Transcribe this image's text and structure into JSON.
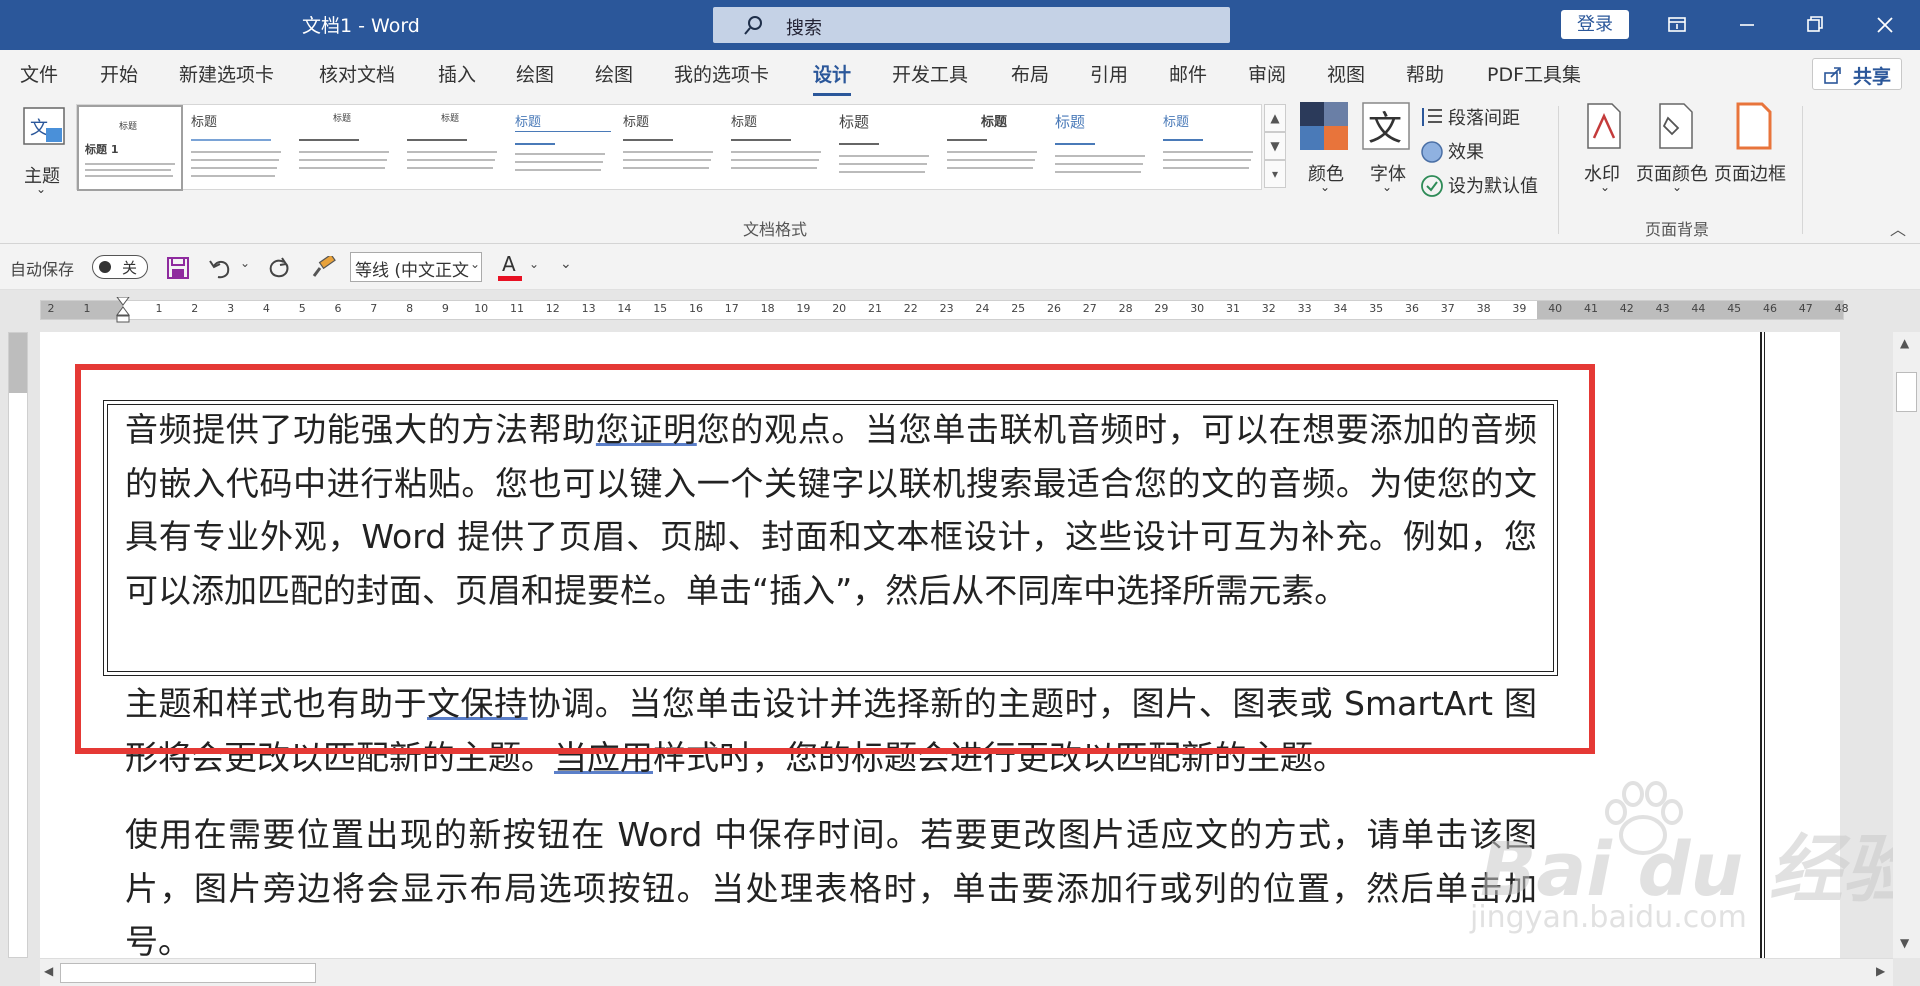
{
  "window": {
    "title": "文档1  -  Word",
    "search_label": "搜索",
    "login_label": "登录"
  },
  "menu": {
    "items": [
      "文件",
      "开始",
      "新建选项卡",
      "核对文档",
      "插入",
      "绘图",
      "绘图",
      "我的选项卡",
      "设计",
      "开发工具",
      "布局",
      "引用",
      "邮件",
      "审阅",
      "视图",
      "帮助",
      "PDF工具集"
    ],
    "active": "设计",
    "share_label": "共享"
  },
  "ribbon": {
    "theme_label": "主题",
    "gallery_heading": "标题",
    "gallery_group_label": "文档格式",
    "colors_label": "颜色",
    "fonts_label": "字体",
    "para_spacing_label": "段落间距",
    "effects_label": "效果",
    "set_default_label": "设为默认值",
    "watermark_label": "水印",
    "page_color_label": "页面颜色",
    "page_border_label": "页面边框",
    "page_bg_group_label": "页面背景"
  },
  "qat": {
    "autosave_label": "自动保存",
    "toggle_state": "关",
    "font_name": "等线 (中文正文"
  },
  "ruler": {
    "left_numbers": [
      "2",
      "1"
    ],
    "numbers": [
      "1",
      "2",
      "3",
      "4",
      "5",
      "6",
      "7",
      "8",
      "9",
      "10",
      "11",
      "12",
      "13",
      "14",
      "15",
      "16",
      "17",
      "18",
      "19",
      "20",
      "21",
      "22",
      "23",
      "24",
      "25",
      "26",
      "27",
      "28",
      "29",
      "30",
      "31",
      "32",
      "33",
      "34",
      "35",
      "36",
      "37",
      "38",
      "39",
      "40",
      "41",
      "42",
      "43",
      "44",
      "45",
      "46",
      "47",
      "48"
    ]
  },
  "document": {
    "para1": [
      "音频提供了功能强大的方法帮助",
      "您证明",
      "您的观点。当您单击联机音频时，可以在想要添加的音频的嵌入代码中进行粘贴。您也可以键入一个关键字以联机搜索最适合您的文的音频。为使您的文具有专业外观，Word 提供了页眉、页脚、封面和文本框设计，这些设计可互为补充。例如，您可以添加匹配的封面、页眉和提要栏。单击“插入”，然后从不同库中选择所需元素。"
    ],
    "para2": [
      "主题和样式也有助于",
      "文保持",
      "协调。当您单击设计并选择新的主题时，图片、图表或 SmartArt 图形将会更改以匹配新的主题。",
      "当应用",
      "样式时，您的标题会进行更改以匹配新的主题。"
    ],
    "para3": "使用在需要位置出现的新按钮在 Word 中保存时间。若要更改图片适应文的方式，请单击该图片，图片旁边将会显示布局选项按钮。当处理表格时，单击要添加行或列的位置，然后单击加号。"
  },
  "watermark": {
    "brand": "Bai du 经验",
    "url": "jingyan.baidu.com"
  },
  "colors": {
    "title_bar": "#2b579a",
    "highlight_box": "#e53935",
    "save_icon": "#8e2a9e",
    "font_color_bar": "#e81123"
  }
}
